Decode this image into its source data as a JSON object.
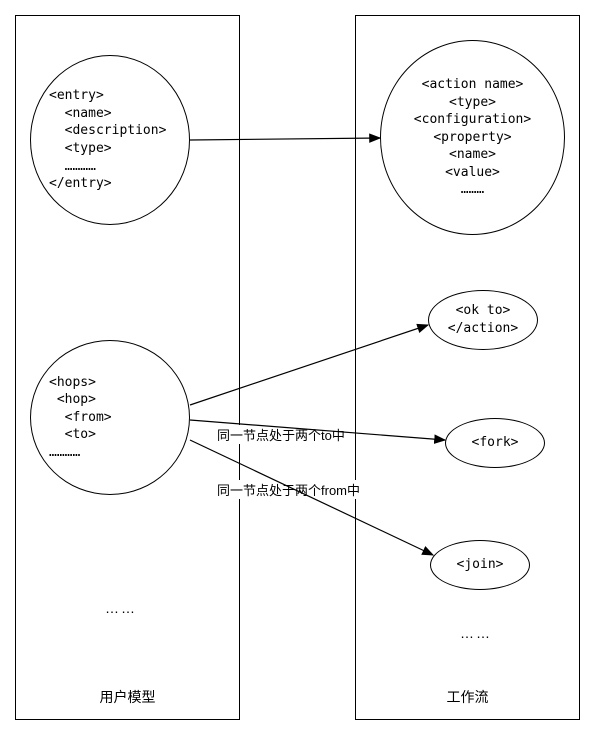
{
  "left_panel": {
    "label": "用户模型",
    "entry_node": {
      "lines": [
        "<entry>",
        "  <name>",
        "  <description>",
        "  <type>",
        "  …………",
        "</entry>"
      ]
    },
    "hops_node": {
      "lines": [
        "<hops>",
        " <hop>",
        "  <from>",
        "  <to>",
        "…………"
      ]
    },
    "ellipsis": "……"
  },
  "right_panel": {
    "label": "工作流",
    "action_node": {
      "lines": [
        "<action name>",
        "<type>",
        "<configuration>",
        "<property>",
        "<name>",
        "<value>",
        "………"
      ]
    },
    "ok_node": {
      "lines": [
        "<ok to>",
        "</action>"
      ]
    },
    "fork_node": {
      "label": "<fork>"
    },
    "join_node": {
      "label": "<join>"
    },
    "ellipsis": "……"
  },
  "edges": {
    "label_fork": "同一节点处于两个to中",
    "label_join": "同一节点处于两个from中"
  }
}
